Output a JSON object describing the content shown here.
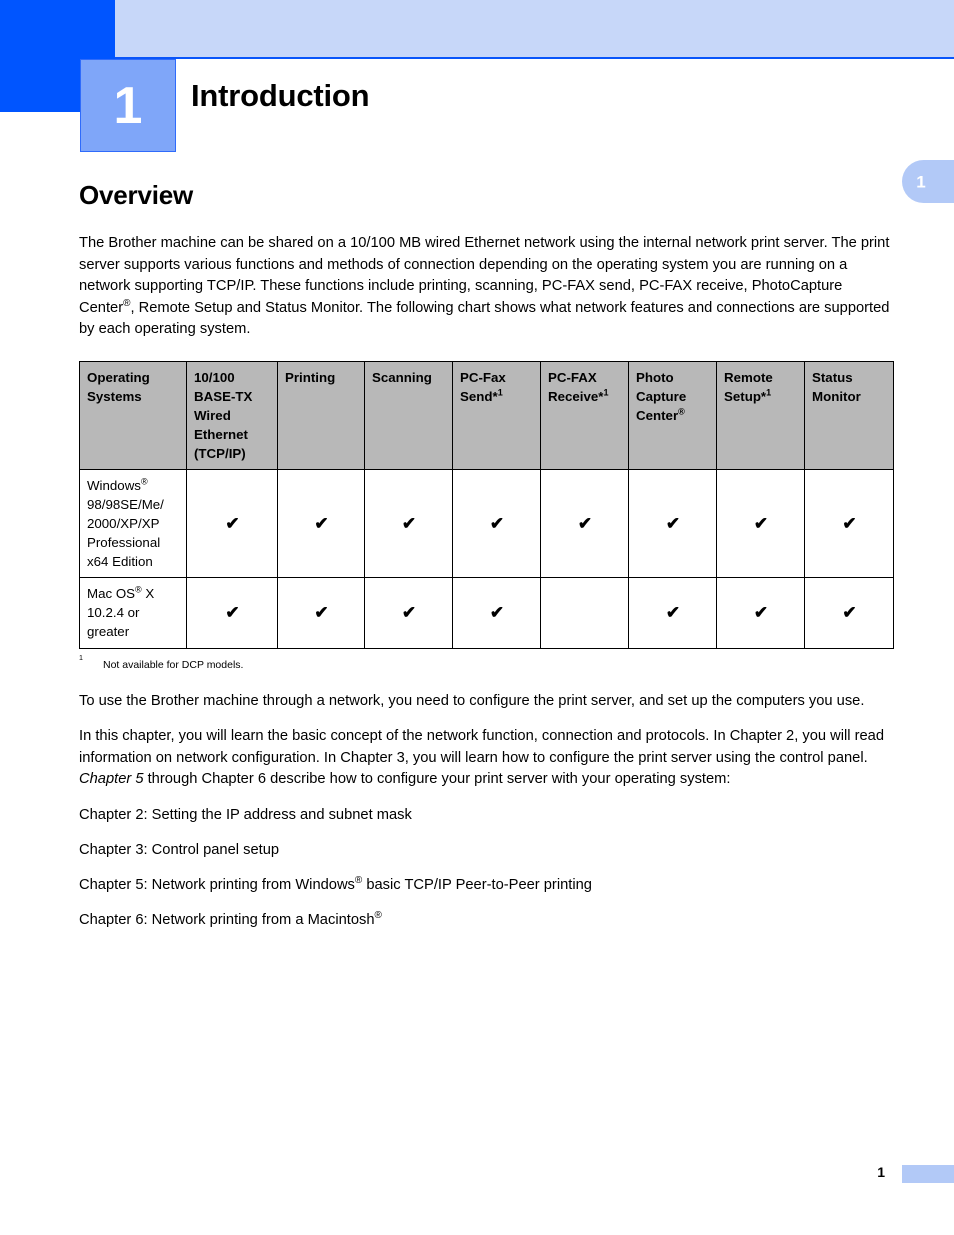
{
  "header": {
    "chapter_number": "1",
    "chapter_title": "Introduction",
    "side_tab_number": "1",
    "band_color": "#c7d7f9",
    "dark_block_color": "#0055ff",
    "chapter_box_color": "#7fa6f9",
    "rule_color": "#0a55fa"
  },
  "section": {
    "heading": "Overview",
    "intro_part1": "The Brother machine can be shared on a 10/100 MB wired Ethernet network using the internal network print server. The print server supports various functions and methods of connection depending on the operating system you are running on a network supporting TCP/IP. These functions include printing, scanning, PC-FAX send, PC-FAX receive, PhotoCapture Center",
    "intro_sup": "®",
    "intro_part2": ", Remote Setup and Status Monitor. The following chart shows what network features and connections are supported by each operating system."
  },
  "table": {
    "header_bg": "#b8b8b8",
    "check_glyph": "✔",
    "columns": [
      {
        "line1": "Operating",
        "line2": "Systems",
        "line3": "",
        "line4": "",
        "line5": ""
      },
      {
        "line1": "10/100",
        "line2": "BASE-TX",
        "line3": "Wired",
        "line4": "Ethernet",
        "line5": "(TCP/IP)"
      },
      {
        "line1": "Printing",
        "line2": "",
        "line3": "",
        "line4": "",
        "line5": ""
      },
      {
        "line1": "Scanning",
        "line2": "",
        "line3": "",
        "line4": "",
        "line5": ""
      },
      {
        "line1": "PC-Fax",
        "line2": "Send*",
        "sup": "1",
        "line3": "",
        "line4": "",
        "line5": ""
      },
      {
        "line1": "PC-FAX",
        "line2": "Receive*",
        "sup": "1",
        "line3": "",
        "line4": "",
        "line5": ""
      },
      {
        "line1": "Photo",
        "line2": "Capture",
        "line3": "Center",
        "reg": "®",
        "line4": "",
        "line5": ""
      },
      {
        "line1": "Remote",
        "line2": "Setup*",
        "sup": "1",
        "line3": "",
        "line4": "",
        "line5": ""
      },
      {
        "line1": "Status",
        "line2": "Monitor",
        "line3": "",
        "line4": "",
        "line5": ""
      }
    ],
    "rows": [
      {
        "os_line1": "Windows",
        "os_reg": "®",
        "os_line2": "98/98SE/Me/",
        "os_line3": "2000/XP/XP",
        "os_line4": "Professional",
        "os_line5": "x64 Edition",
        "support": [
          true,
          true,
          true,
          true,
          true,
          true,
          true,
          true
        ]
      },
      {
        "os_line1": "Mac OS",
        "os_reg": "®",
        "os_line1b": " X",
        "os_line2": "10.2.4 or",
        "os_line3": "greater",
        "os_line4": "",
        "os_line5": "",
        "support": [
          true,
          true,
          true,
          true,
          false,
          true,
          true,
          true
        ]
      }
    ]
  },
  "footnote": {
    "number": "1",
    "text": "Not available for DCP models."
  },
  "body": {
    "para_network": "To use the Brother machine through a network, you need to configure the print server, and set up the computers you use.",
    "para_chapter_a": "In this chapter, you will learn the basic concept of the network function, connection and protocols. In Chapter 2, you will read information on network configuration. In Chapter 3, you will learn how to configure the print server using the control panel. ",
    "para_chapter_italic": "Chapter 5",
    "para_chapter_b": " through Chapter 6 describe how to configure your print server with your operating system:"
  },
  "chapter_list": [
    {
      "text": "Chapter 2: Setting the IP address and subnet mask"
    },
    {
      "text": "Chapter 3: Control panel setup"
    },
    {
      "pre": "Chapter 5: Network printing from Windows",
      "reg": "®",
      "post": " basic TCP/IP Peer-to-Peer printing"
    },
    {
      "pre": "Chapter 6: Network printing from a Macintosh",
      "reg": "®",
      "post": ""
    }
  ],
  "footer": {
    "page_number": "1",
    "bar_color": "#b2c9f7"
  }
}
